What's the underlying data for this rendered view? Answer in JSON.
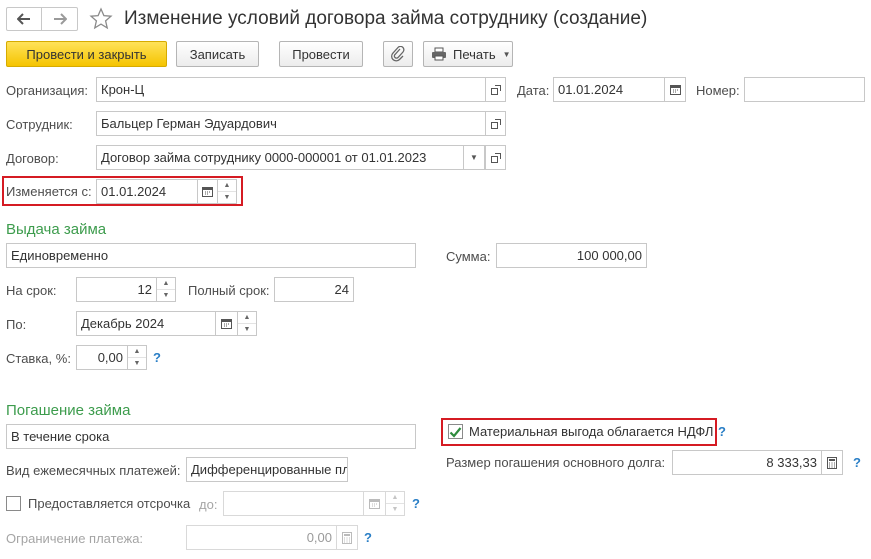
{
  "window": {
    "title": "Изменение условий договора займа сотруднику (создание)"
  },
  "toolbar": {
    "post_close_label": "Провести и закрыть",
    "save_label": "Записать",
    "post_label": "Провести",
    "print_label": "Печать"
  },
  "header": {
    "organization_label": "Организация:",
    "organization_value": "Крон-Ц",
    "date_label": "Дата:",
    "date_value": "01.01.2024",
    "number_label": "Номер:",
    "number_value": "",
    "employee_label": "Сотрудник:",
    "employee_value": "Бальцер Герман Эдуардович",
    "contract_label": "Договор:",
    "contract_value": "Договор займа сотруднику 0000-000001 от 01.01.2023",
    "changed_from_label": "Изменяется с:",
    "changed_from_value": "01.01.2024"
  },
  "loan_issue": {
    "section_title": "Выдача займа",
    "method_value": "Единовременно",
    "amount_label": "Сумма:",
    "amount_value": "100 000,00",
    "term_label": "На срок:",
    "term_value": "12",
    "full_term_label": "Полный срок:",
    "full_term_value": "24",
    "until_label": "По:",
    "until_value": "Декабрь 2024",
    "rate_label": "Ставка, %:",
    "rate_value": "0,00",
    "help_symbol": "?"
  },
  "repayment": {
    "section_title": "Погашение займа",
    "method_value": "В течение срока",
    "payment_type_label": "Вид ежемесячных платежей:",
    "payment_type_value": "Дифференцированные пл",
    "benefit_label": "Материальная выгода облагается НДФЛ",
    "benefit_checked": true,
    "principal_label": "Размер погашения основного долга:",
    "principal_value": "8 333,33",
    "deferral_label": "Предоставляется отсрочка",
    "deferral_checked": false,
    "deferral_to_label": "до:",
    "deferral_to_value": "",
    "limit_label": "Ограничение платежа:",
    "limit_value": "0,00",
    "help_symbol": "?"
  },
  "colors": {
    "accent_section": "#3d9c4d",
    "primary_button": "#f5c400",
    "highlight_border": "#d51b23",
    "help_link": "#2a7fc6"
  }
}
